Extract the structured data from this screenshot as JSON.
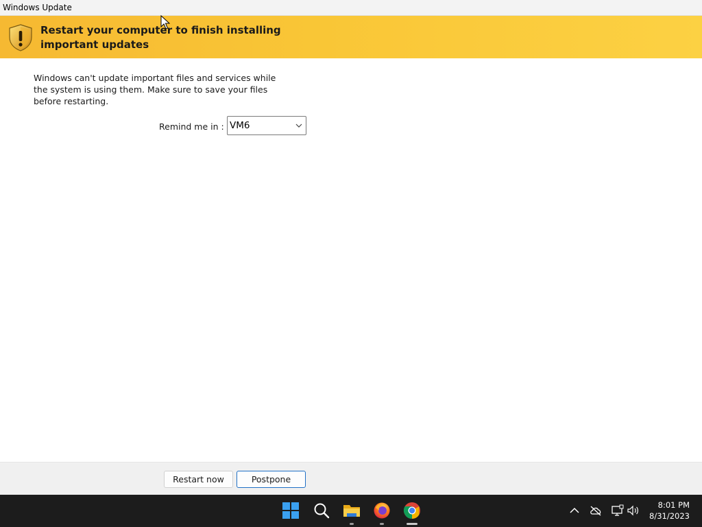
{
  "window": {
    "title": "Windows Update"
  },
  "banner": {
    "icon": "warning-shield-icon",
    "headline": "Restart your computer to finish installing important updates"
  },
  "main": {
    "message": "Windows can't update important files and services while the system is using them. Make sure to save your files before restarting.",
    "remind_label": "Remind me in :",
    "remind_value": "VM6"
  },
  "footer": {
    "restart_label": "Restart now",
    "postpone_label": "Postpone"
  },
  "taskbar": {
    "apps": [
      "start-icon",
      "search-icon",
      "file-explorer-icon",
      "firefox-icon",
      "chrome-icon"
    ],
    "tray": [
      "chevron-up-icon",
      "cloud-off-icon",
      "network-icon",
      "volume-icon"
    ],
    "time": "8:01 PM",
    "date": "8/31/2023"
  },
  "colors": {
    "banner": "#f9c636",
    "taskbar": "#1c1c1c",
    "accent": "#1f6fc5"
  }
}
